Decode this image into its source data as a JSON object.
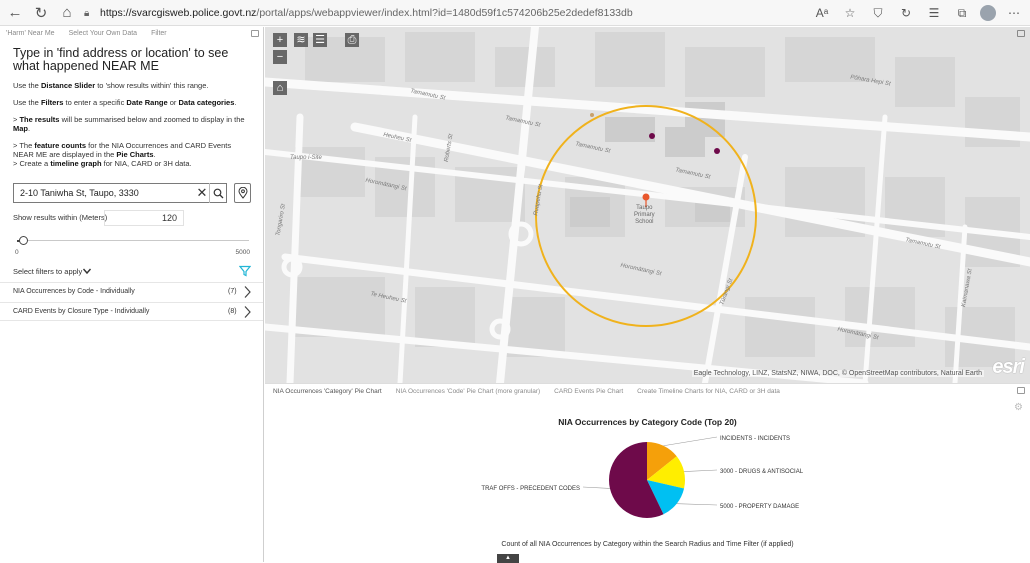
{
  "browser": {
    "url_host": "https://svarcgisweb.police.govt.nz",
    "url_rest": "/portal/apps/webappviewer/index.html?id=1480d59f1c574206b25e2dedef8133db",
    "read_aloud": "Aᵃ"
  },
  "left_panel": {
    "tabs": [
      "'Harm' Near Me",
      "Select Your Own Data",
      "Filter"
    ],
    "title": "Type in 'find address or location' to see what happened NEAR ME",
    "instructions": [
      {
        "pre": "Use the ",
        "bold": "Distance Slider",
        "post": " to 'show results within' this range."
      },
      {
        "pre": "Use the ",
        "bold": "Filters",
        "mid": " to enter a specific ",
        "bold2": "Date Range",
        "mid2": " or ",
        "bold3": "Data categories",
        "post": "."
      },
      {
        "pre": "> ",
        "bold": "The results",
        "post": " will be summarised below and zoomed to display in the ",
        "bold_end": "Map",
        "end": "."
      },
      {
        "pre": "> The ",
        "bold": "feature counts",
        "post": " for the NIA Occurrences and CARD Events NEAR ME are displayed in the ",
        "bold_end": "Pie Charts",
        "end": ".",
        "line2": "> Create a ",
        "line2_bold": "timeline graph",
        "line2_post": " for NIA, CARD or 3H data."
      }
    ],
    "search": {
      "value": "2-10 Taniwha St, Taupo, 3330",
      "clear": "✕"
    },
    "radius": {
      "label": "Show results within (Meters)",
      "value": "120"
    },
    "slider": {
      "min": "0",
      "max": "5000",
      "value": 120
    },
    "filters": {
      "label": "Select filters to apply"
    },
    "results": [
      {
        "label": "NIA Occurrences by Code - Individually",
        "count": "(7)"
      },
      {
        "label": "CARD Events by Closure Type - Individually",
        "count": "(8)"
      }
    ]
  },
  "map": {
    "attribution": "Eagle Technology, LINZ, StatsNZ, NIWA, DOC, © OpenStreetMap contributors, Natural Earth",
    "logo": "esri",
    "buttons": [
      "+",
      "−"
    ],
    "streets": [
      {
        "name": "Tamamutu St"
      },
      {
        "name": "Tamamutu St"
      },
      {
        "name": "Tamamutu St"
      },
      {
        "name": "Tamamutu St"
      },
      {
        "name": "Tamamutu St"
      },
      {
        "name": "Tamamutu St"
      },
      {
        "name": "Pōhara Hepi St"
      },
      {
        "name": "Heuheu St"
      },
      {
        "name": "Te Heuheu St"
      },
      {
        "name": "Horomātangi St"
      },
      {
        "name": "Horomātangi St"
      },
      {
        "name": "Horomātangi St"
      },
      {
        "name": "Horomātangi St"
      },
      {
        "name": "Tongariro St"
      },
      {
        "name": "Roberts St"
      },
      {
        "name": "Ruapehu St"
      },
      {
        "name": "Tūrangi St"
      },
      {
        "name": "Kaimanawa St"
      },
      {
        "name": "Te Heuheu St"
      },
      {
        "name": "Taupo i-Site"
      },
      {
        "name": "Spa Rd"
      },
      {
        "name": "Paora Hapi St"
      },
      {
        "name": "Rangatira St"
      },
      {
        "name": "Kaipanga St"
      }
    ],
    "school": "Taupo\nPrimary\nSchool"
  },
  "chart_panel": {
    "tabs": [
      "NIA Occurrences 'Category' Pie Chart",
      "NIA Occurrences 'Code' Pie Chart (more granular)",
      "CARD Events Pie Chart",
      "Create Timeline Charts for NIA, CARD or 3H data"
    ],
    "footnote": "Count of all NIA Occurrences by Category within the Search Radius and Time Filter (if applied)",
    "collapse": "▲"
  },
  "chart_data": {
    "type": "pie",
    "title": "NIA Occurrences by Category Code (Top 20)",
    "slices": [
      {
        "label": "INCIDENTS - INCIDENTS",
        "value": 1,
        "color": "#f5a00a"
      },
      {
        "label": "3000 - DRUGS & ANTISOCIAL",
        "value": 1,
        "color": "#ffee00"
      },
      {
        "label": "5000 - PROPERTY DAMAGE",
        "value": 1,
        "color": "#00c0f2"
      },
      {
        "label": "TRAF OFFS - PRECEDENT CODES",
        "value": 4,
        "color": "#6e0a4a"
      }
    ]
  },
  "colors": {
    "radius_circle": "#f0b21c",
    "marker": "#6e0a4a",
    "pin": "#e8572c",
    "filter_icon": "#22b6d6"
  }
}
